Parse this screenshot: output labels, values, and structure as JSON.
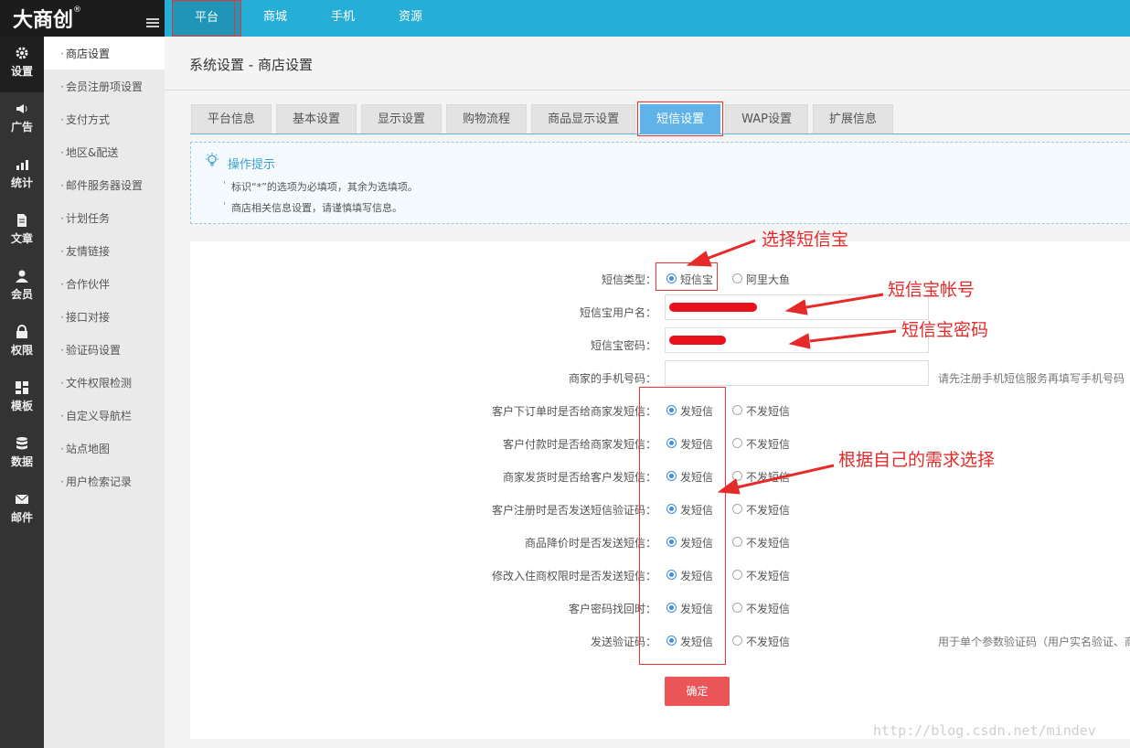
{
  "logo": {
    "text": "大商创",
    "mark": "®"
  },
  "topnav": [
    {
      "label": "平台",
      "active": true
    },
    {
      "label": "商城",
      "active": false
    },
    {
      "label": "手机",
      "active": false
    },
    {
      "label": "资源",
      "active": false
    }
  ],
  "iconbar": [
    {
      "label": "设置",
      "icon": "gear-icon",
      "active": true
    },
    {
      "label": "广告",
      "icon": "megaphone-icon",
      "active": false
    },
    {
      "label": "统计",
      "icon": "chart-icon",
      "active": false
    },
    {
      "label": "文章",
      "icon": "document-icon",
      "active": false
    },
    {
      "label": "会员",
      "icon": "user-icon",
      "active": false
    },
    {
      "label": "权限",
      "icon": "lock-icon",
      "active": false
    },
    {
      "label": "模板",
      "icon": "grid-icon",
      "active": false
    },
    {
      "label": "数据",
      "icon": "database-icon",
      "active": false
    },
    {
      "label": "邮件",
      "icon": "mail-icon",
      "active": false
    }
  ],
  "submenu": [
    {
      "label": "商店设置",
      "active": true
    },
    {
      "label": "会员注册项设置",
      "active": false
    },
    {
      "label": "支付方式",
      "active": false
    },
    {
      "label": "地区&配送",
      "active": false
    },
    {
      "label": "邮件服务器设置",
      "active": false
    },
    {
      "label": "计划任务",
      "active": false
    },
    {
      "label": "友情链接",
      "active": false
    },
    {
      "label": "合作伙伴",
      "active": false
    },
    {
      "label": "接口对接",
      "active": false
    },
    {
      "label": "验证码设置",
      "active": false
    },
    {
      "label": "文件权限检测",
      "active": false
    },
    {
      "label": "自定义导航栏",
      "active": false
    },
    {
      "label": "站点地图",
      "active": false
    },
    {
      "label": "用户检索记录",
      "active": false
    }
  ],
  "breadcrumb": "系统设置 - 商店设置",
  "tabs": [
    {
      "label": "平台信息",
      "active": false
    },
    {
      "label": "基本设置",
      "active": false
    },
    {
      "label": "显示设置",
      "active": false
    },
    {
      "label": "购物流程",
      "active": false
    },
    {
      "label": "商品显示设置",
      "active": false
    },
    {
      "label": "短信设置",
      "active": true
    },
    {
      "label": "WAP设置",
      "active": false
    },
    {
      "label": "扩展信息",
      "active": false
    }
  ],
  "hint": {
    "title": "操作提示",
    "lines": [
      "标识“*”的选项为必填项，其余为选填项。",
      "商店相关信息设置，请谨慎填写信息。"
    ]
  },
  "form": {
    "sms_type": {
      "label": "短信类型：",
      "options": [
        "短信宝",
        "阿里大鱼"
      ],
      "selected": 0
    },
    "username": {
      "label": "短信宝用户名：",
      "value": ""
    },
    "password": {
      "label": "短信宝密码：",
      "value": ""
    },
    "phone": {
      "label": "商家的手机号码：",
      "value": "",
      "tip": "请先注册手机短信服务再填写手机号码"
    },
    "send_label": "发短信",
    "nosend_label": "不发短信",
    "switches": [
      {
        "label": "客户下订单时是否给商家发短信：",
        "selected": 0
      },
      {
        "label": "客户付款时是否给商家发短信：",
        "selected": 0
      },
      {
        "label": "商家发货时是否给客户发短信：",
        "selected": 0
      },
      {
        "label": "客户注册时是否发送短信验证码：",
        "selected": 0
      },
      {
        "label": "商品降价时是否发送短信：",
        "selected": 0
      },
      {
        "label": "修改入住商权限时是否发送短信：",
        "selected": 0
      },
      {
        "label": "客户密码找回时：",
        "selected": 0
      },
      {
        "label": "发送验证码：",
        "selected": 0,
        "tip": "用于单个参数验证码（用户实名验证、商"
      }
    ],
    "submit_label": "确定"
  },
  "annotations": {
    "select_provider": "选择短信宝",
    "account": "短信宝帐号",
    "password": "短信宝密码",
    "choose_needs": "根据自己的需求选择"
  },
  "watermark": "http://blog.csdn.net/mindev",
  "colors": {
    "topbar": "#27aed6",
    "tab_active": "#5fb3e8",
    "submit": "#ea5657",
    "annotation": "#e62a2a"
  }
}
